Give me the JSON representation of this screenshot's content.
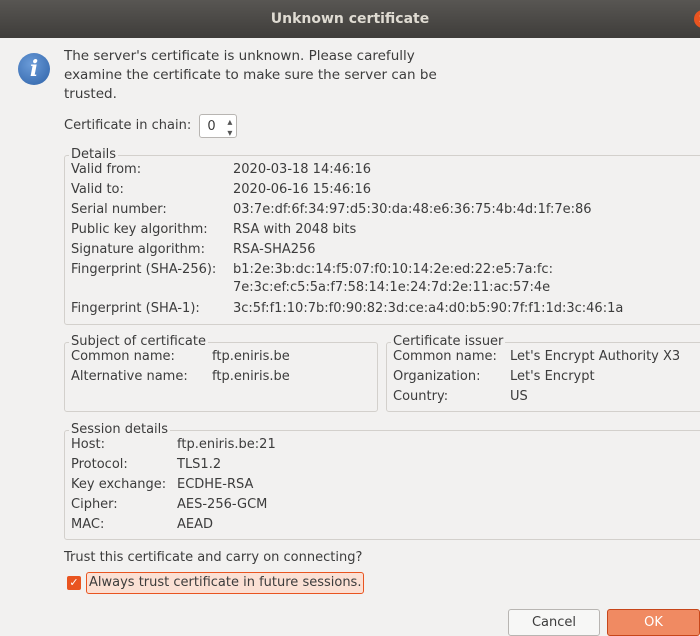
{
  "window": {
    "title": "Unknown certificate"
  },
  "intro": "The server's certificate is unknown. Please carefully examine the certificate to make sure the server can be trusted.",
  "chain": {
    "label": "Certificate in chain:",
    "value": "0"
  },
  "details": {
    "legend": "Details",
    "valid_from_label": "Valid from:",
    "valid_from": "2020-03-18 14:46:16",
    "valid_to_label": "Valid to:",
    "valid_to": "2020-06-16 15:46:16",
    "serial_label": "Serial number:",
    "serial": "03:7e:df:6f:34:97:d5:30:da:48:e6:36:75:4b:4d:1f:7e:86",
    "pubkey_label": "Public key algorithm:",
    "pubkey": "RSA with 2048 bits",
    "sigalg_label": "Signature algorithm:",
    "sigalg": "RSA-SHA256",
    "sha256_label": "Fingerprint (SHA-256):",
    "sha256_line1": "b1:2e:3b:dc:14:f5:07:f0:10:14:2e:ed:22:e5:7a:fc:",
    "sha256_line2": "7e:3c:ef:c5:5a:f7:58:14:1e:24:7d:2e:11:ac:57:4e",
    "sha1_label": "Fingerprint (SHA-1):",
    "sha1": "3c:5f:f1:10:7b:f0:90:82:3d:ce:a4:d0:b5:90:7f:f1:1d:3c:46:1a"
  },
  "subject": {
    "legend": "Subject of certificate",
    "cn_label": "Common name:",
    "cn": "ftp.eniris.be",
    "alt_label": "Alternative name:",
    "alt": "ftp.eniris.be"
  },
  "issuer": {
    "legend": "Certificate issuer",
    "cn_label": "Common name:",
    "cn": "Let's Encrypt Authority X3",
    "org_label": "Organization:",
    "org": "Let's Encrypt",
    "country_label": "Country:",
    "country": "US"
  },
  "session": {
    "legend": "Session details",
    "host_label": "Host:",
    "host": "ftp.eniris.be:21",
    "protocol_label": "Protocol:",
    "protocol": "TLS1.2",
    "kex_label": "Key exchange:",
    "kex": "ECDHE-RSA",
    "cipher_label": "Cipher:",
    "cipher": "AES-256-GCM",
    "mac_label": "MAC:",
    "mac": "AEAD"
  },
  "question": "Trust this certificate and carry on connecting?",
  "always_trust": {
    "label": "Always trust certificate in future sessions.",
    "checked": true
  },
  "buttons": {
    "cancel": "Cancel",
    "ok": "OK"
  },
  "colors": {
    "accent": "#e95420",
    "titlebar": "#3f3d3a",
    "background": "#f2f1f0"
  }
}
